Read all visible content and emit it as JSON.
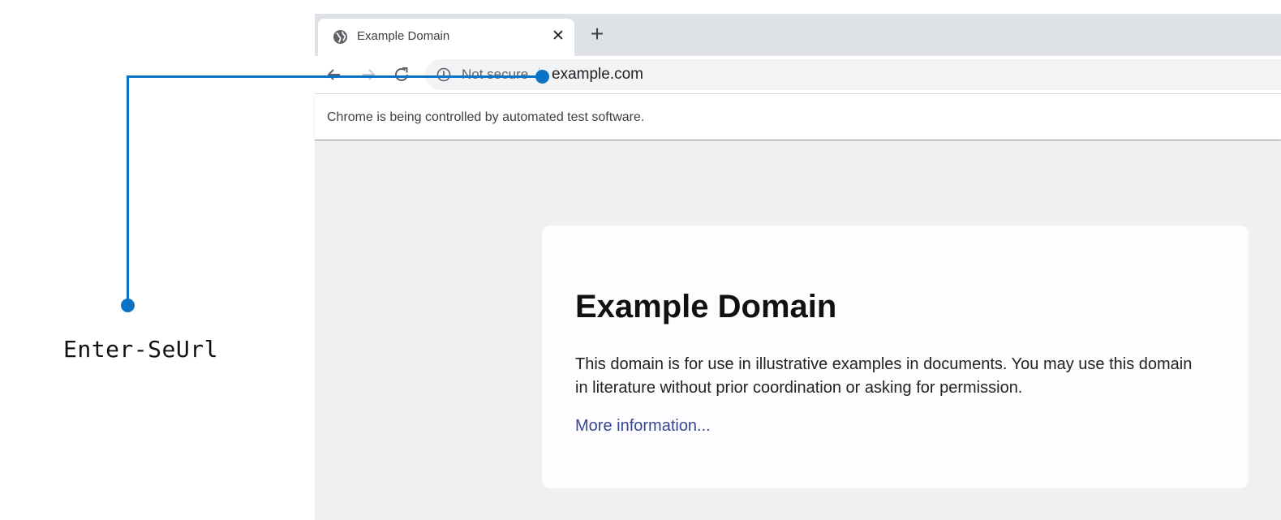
{
  "annotation": {
    "label": "Enter-SeUrl",
    "color": "#0b73c6"
  },
  "browser": {
    "tab": {
      "title": "Example Domain",
      "close_symbol": "✕",
      "icon": "globe-icon"
    },
    "new_tab_symbol": "+",
    "toolbar": {
      "back_icon": "back-arrow-icon",
      "forward_icon": "forward-arrow-icon",
      "reload_icon": "reload-icon",
      "security_icon": "info-icon",
      "security_text": "Not secure",
      "url": "example.com"
    },
    "infobar": {
      "text": "Chrome is being controlled by automated test software."
    }
  },
  "page": {
    "heading": "Example Domain",
    "paragraph": "This domain is for use in illustrative examples in documents. You may use this domain in literature without prior coordination or asking for permission.",
    "link_text": "More information..."
  }
}
